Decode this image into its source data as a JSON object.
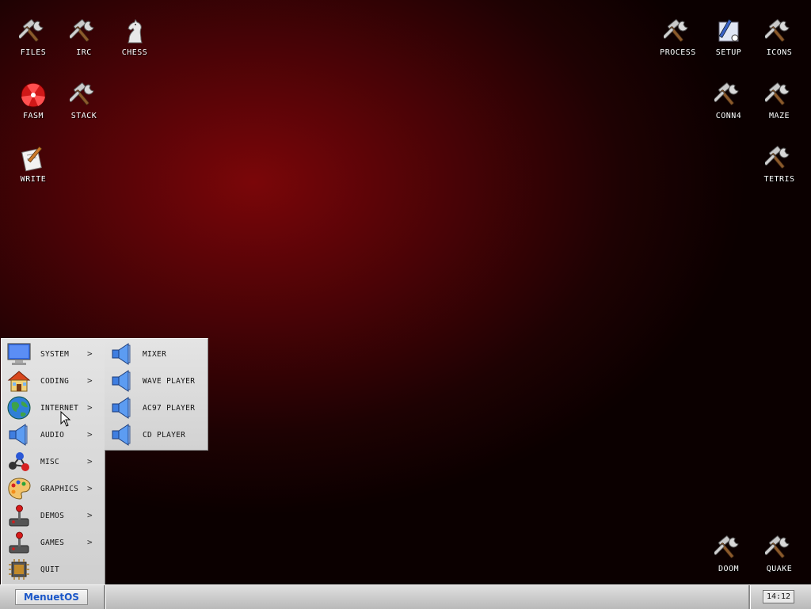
{
  "desktop_icons": [
    {
      "label": "FILES",
      "icon": "tools-icon"
    },
    {
      "label": "IRC",
      "icon": "tools-icon"
    },
    {
      "label": "CHESS",
      "icon": "chess-knight-icon"
    },
    {
      "label": "FASM",
      "icon": "fasm-icon"
    },
    {
      "label": "STACK",
      "icon": "tools-icon"
    },
    {
      "label": "WRITE",
      "icon": "write-icon"
    },
    {
      "label": "PROCESS",
      "icon": "tools-icon"
    },
    {
      "label": "SETUP",
      "icon": "setup-icon"
    },
    {
      "label": "ICONS",
      "icon": "tools-icon"
    },
    {
      "label": "CONN4",
      "icon": "tools-icon"
    },
    {
      "label": "MAZE",
      "icon": "tools-icon"
    },
    {
      "label": "TETRIS",
      "icon": "tools-icon"
    },
    {
      "label": "DOOM",
      "icon": "tools-icon"
    },
    {
      "label": "QUAKE",
      "icon": "tools-icon"
    }
  ],
  "start_menu": {
    "items": [
      {
        "label": "SYSTEM",
        "icon": "monitor-icon",
        "has_submenu": true
      },
      {
        "label": "CODING",
        "icon": "house-icon",
        "has_submenu": true
      },
      {
        "label": "INTERNET",
        "icon": "globe-icon",
        "has_submenu": true
      },
      {
        "label": "AUDIO",
        "icon": "speaker-icon",
        "has_submenu": true
      },
      {
        "label": "MISC",
        "icon": "molecule-icon",
        "has_submenu": true
      },
      {
        "label": "GRAPHICS",
        "icon": "palette-icon",
        "has_submenu": true
      },
      {
        "label": "DEMOS",
        "icon": "joystick-icon",
        "has_submenu": true
      },
      {
        "label": "GAMES",
        "icon": "joystick-icon",
        "has_submenu": true
      },
      {
        "label": "QUIT",
        "icon": "chip-icon",
        "has_submenu": false
      }
    ],
    "arrow_glyph": ">"
  },
  "audio_submenu": {
    "items": [
      {
        "label": "MIXER",
        "icon": "speaker-icon"
      },
      {
        "label": "WAVE PLAYER",
        "icon": "speaker-icon"
      },
      {
        "label": "AC97 PLAYER",
        "icon": "speaker-icon"
      },
      {
        "label": "CD PLAYER",
        "icon": "speaker-icon"
      }
    ]
  },
  "taskbar": {
    "start_label": "MenuetOS",
    "clock": "14:12"
  },
  "colors": {
    "desktop_center": "#7a0609",
    "desktop_edge": "#0b0000",
    "menu_bg": "#dcdcdc",
    "start_text": "#1a56c8"
  }
}
